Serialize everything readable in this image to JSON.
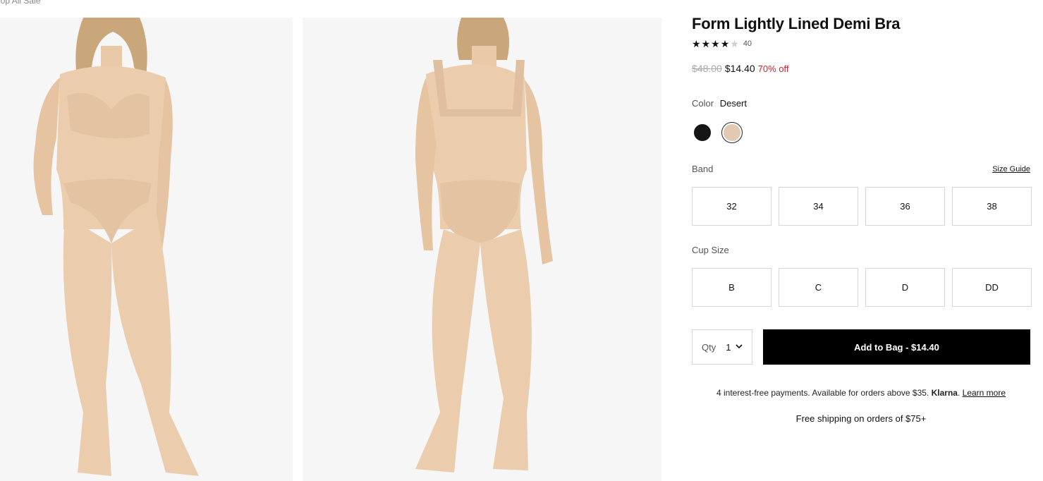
{
  "breadcrumb": "hop All Sale",
  "product": {
    "title": "Form Lightly Lined Demi Bra",
    "rating_count": "40",
    "rating_stars": 4,
    "old_price": "$48.00",
    "new_price": "$14.40",
    "discount": "70% off"
  },
  "color": {
    "label": "Color",
    "selected": "Desert",
    "swatches": [
      {
        "name": "black",
        "hex": "#161616"
      },
      {
        "name": "desert",
        "hex": "#e2c9b2"
      }
    ]
  },
  "band": {
    "label": "Band",
    "size_guide": "Size Guide",
    "options": [
      "32",
      "34",
      "36",
      "38"
    ]
  },
  "cup": {
    "label": "Cup Size",
    "options": [
      "B",
      "C",
      "D",
      "DD"
    ]
  },
  "qty": {
    "label": "Qty",
    "value": "1"
  },
  "add_to_bag": "Add to Bag  -  $14.40",
  "klarna": {
    "text": "4 interest-free payments. Available for orders above $35.",
    "brand": "Klarna",
    "link": "Learn more"
  },
  "shipping": "Free shipping on orders of $75+"
}
